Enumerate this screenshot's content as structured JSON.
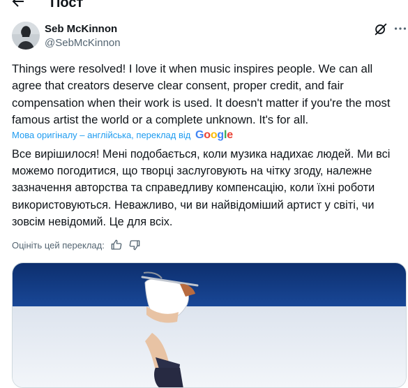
{
  "header": {
    "title": "Пост",
    "back_icon": "arrow-left-icon"
  },
  "author": {
    "display_name": "Seb McKinnon",
    "handle": "@SebMcKinnon",
    "avatar": "avatar-photo",
    "grok_icon": "grok-icon",
    "more_icon": "more-horizontal-icon"
  },
  "tweet": {
    "text": "Things were resolved! I love it when music inspires people. We can all agree that creators deserve clear consent, proper credit, and fair compensation when their work is used. It doesn't matter if you're the most famous artist the world or a complete unknown. It's for all.",
    "translation_notice": "Мова оригіналу – англійська, переклад від",
    "translation_provider": "Google",
    "translated_text": "Все вирішилося! Мені подобається, коли музика надихає людей. Ми всі можемо погодитися, що творці заслуговують на чітку згоду, належне зазначення авторства та справедливу компенсацію, коли їхні роботи використовуються. Неважливо, чи ви найвідоміший артист у світі, чи зовсім невідомий. Це для всіх.",
    "rate_translation_label": "Оцініть цей переклад:",
    "thumbs_up_icon": "thumbs-up-icon",
    "thumbs_down_icon": "thumbs-down-icon"
  },
  "media": {
    "description_icon": "figure-skater-photo"
  },
  "colors": {
    "text": "#0f1419",
    "secondary": "#536471",
    "accent": "#1d9bf0"
  }
}
